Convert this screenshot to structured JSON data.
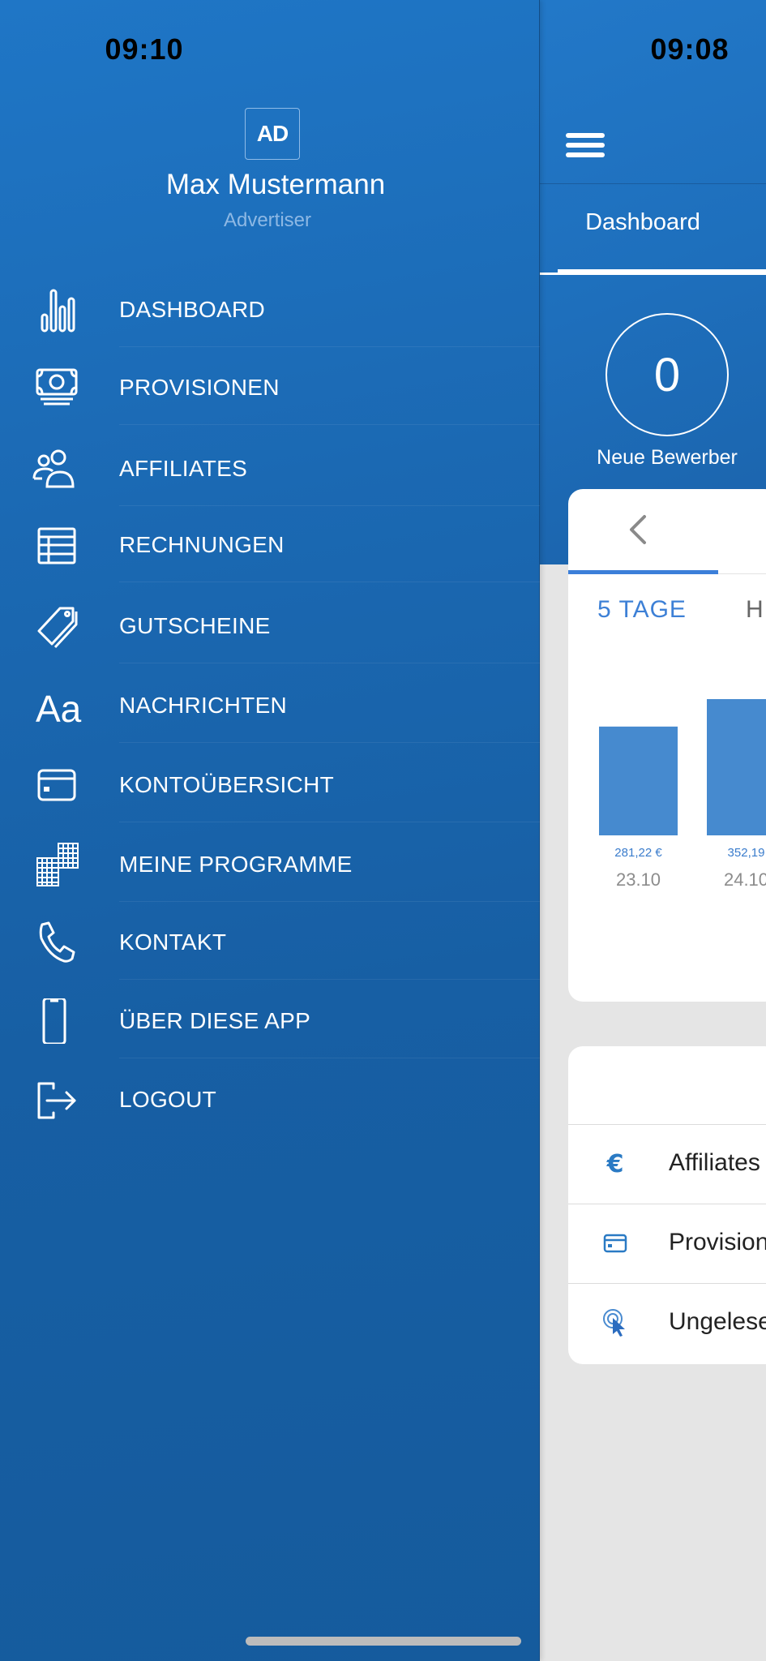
{
  "drawer": {
    "status_time": "09:10",
    "logo_text": "AD",
    "user_name": "Max Mustermann",
    "user_role": "Advertiser",
    "menu": [
      {
        "label": "DASHBOARD",
        "icon": "bar-chart-icon"
      },
      {
        "label": "PROVISIONEN",
        "icon": "money-icon"
      },
      {
        "label": "AFFILIATES",
        "icon": "users-icon"
      },
      {
        "label": "RECHNUNGEN",
        "icon": "table-icon"
      },
      {
        "label": "GUTSCHEINE",
        "icon": "tag-icon"
      },
      {
        "label": "NACHRICHTEN",
        "icon": "font-icon"
      },
      {
        "label": "KONTOÜBERSICHT",
        "icon": "credit-card-icon"
      },
      {
        "label": "MEINE PROGRAMME",
        "icon": "grid-icon"
      },
      {
        "label": "KONTAKT",
        "icon": "phone-icon"
      },
      {
        "label": "ÜBER DIESE APP",
        "icon": "smartphone-icon"
      },
      {
        "label": "LOGOUT",
        "icon": "logout-icon"
      }
    ]
  },
  "main": {
    "status_time": "09:08",
    "tab_label": "Dashboard",
    "stat": {
      "value": "0",
      "label": "Neue Bewerber"
    },
    "chart_card": {
      "period_active": "5 TAGE",
      "period_next_partial": "H"
    },
    "list_card": {
      "rows": [
        {
          "icon": "euro-icon",
          "label": "Affiliates"
        },
        {
          "icon": "credit-card-icon",
          "label": "Provision"
        },
        {
          "icon": "click-icon",
          "label": "Ungelese"
        }
      ]
    }
  },
  "colors": {
    "drawer_blue": "#1b69b3",
    "accent_blue": "#3d80d6",
    "bar_blue": "#468acf",
    "background_gray": "#e5e5e5"
  },
  "chart_data": {
    "type": "bar",
    "categories": [
      "23.10",
      "24.10"
    ],
    "values": [
      281.22,
      352.19
    ],
    "value_labels": [
      "281,22 €",
      "352,19"
    ],
    "title": "",
    "xlabel": "",
    "ylabel": "",
    "ylim": [
      0,
      352.19
    ],
    "grid": false,
    "note": "Chart partially visible; further bars clipped by drawer/viewport"
  }
}
